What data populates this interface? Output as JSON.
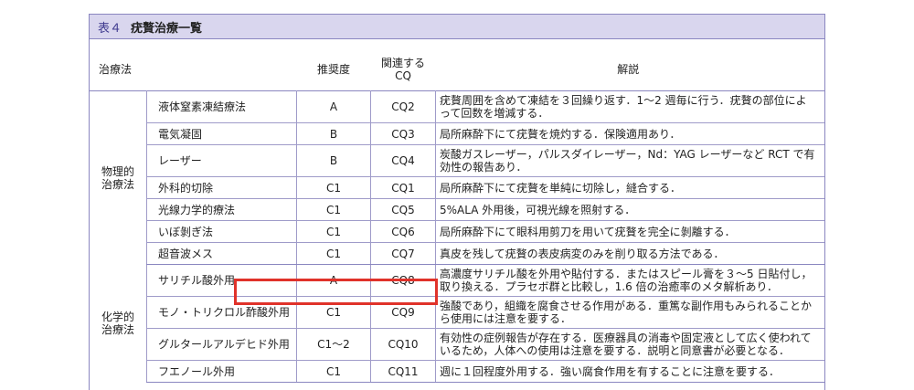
{
  "table_number": "表４",
  "table_title": "疣贅治療一覧",
  "headers": {
    "category": "治療法",
    "grade": "推奨度",
    "cq": "関連する CQ",
    "description": "解説"
  },
  "groups": [
    {
      "category": "物理的 治療法",
      "rows": [
        {
          "name": "液体窒素凍結療法",
          "grade": "A",
          "cq": "CQ2",
          "description": "疣贅周囲を含めて凍結を３回繰り返す．1〜2 週毎に行う．疣贅の部位によって回数を増減する．"
        },
        {
          "name": "電気凝固",
          "grade": "B",
          "cq": "CQ3",
          "description": "局所麻酔下にて疣贅を焼灼する．保険適用あり．"
        },
        {
          "name": "レーザー",
          "grade": "B",
          "cq": "CQ4",
          "description": "炭酸ガスレーザー，パルスダイレーザー，Nd：YAG レーザーなど RCT で有効性の報告あり．"
        },
        {
          "name": "外科的切除",
          "grade": "C1",
          "cq": "CQ1",
          "description": "局所麻酔下にて疣贅を単純に切除し，縫合する．"
        },
        {
          "name": "光線力学的療法",
          "grade": "C1",
          "cq": "CQ5",
          "description": "5%ALA 外用後，可視光線を照射する．"
        },
        {
          "name": "いぼ剝ぎ法",
          "grade": "C1",
          "cq": "CQ6",
          "description": "局所麻酔下にて眼科用剪刀を用いて疣贅を完全に剝離する．"
        },
        {
          "name": "超音波メス",
          "grade": "C1",
          "cq": "CQ7",
          "description": "真皮を残して疣贅の表皮病変のみを削り取る方法である．"
        }
      ]
    },
    {
      "category": "化学的 治療法",
      "rows": [
        {
          "name": "サリチル酸外用",
          "grade": "A",
          "cq": "CQ8",
          "description": "高濃度サリチル酸を外用や貼付する．またはスピール膏を３〜5 日貼付し，取り換える．プラセボ群と比較し，1.6 倍の治癒率のメタ解析あり．"
        },
        {
          "name": "モノ・トリクロル酢酸外用",
          "grade": "C1",
          "cq": "CQ9",
          "description": "強酸であり，組織を腐食させる作用がある．重篤な副作用もみられることから使用には注意を要する．"
        },
        {
          "name": "グルタールアルデヒド外用",
          "grade": "C1〜2",
          "cq": "CQ10",
          "description": "有効性の症例報告が存在する．医療器具の消毒や固定液として広く使われているため，人体への使用は注意を要する．説明と同意書が必要となる．"
        },
        {
          "name": "フエノール外用",
          "grade": "C1",
          "cq": "CQ11",
          "description": "週に１回程度外用する．強い腐食作用を有することに注意を要する．"
        }
      ]
    }
  ],
  "highlight_color": "#e0322a",
  "accent_color": "#8a86c0",
  "header_bg": "#d9d6ee"
}
